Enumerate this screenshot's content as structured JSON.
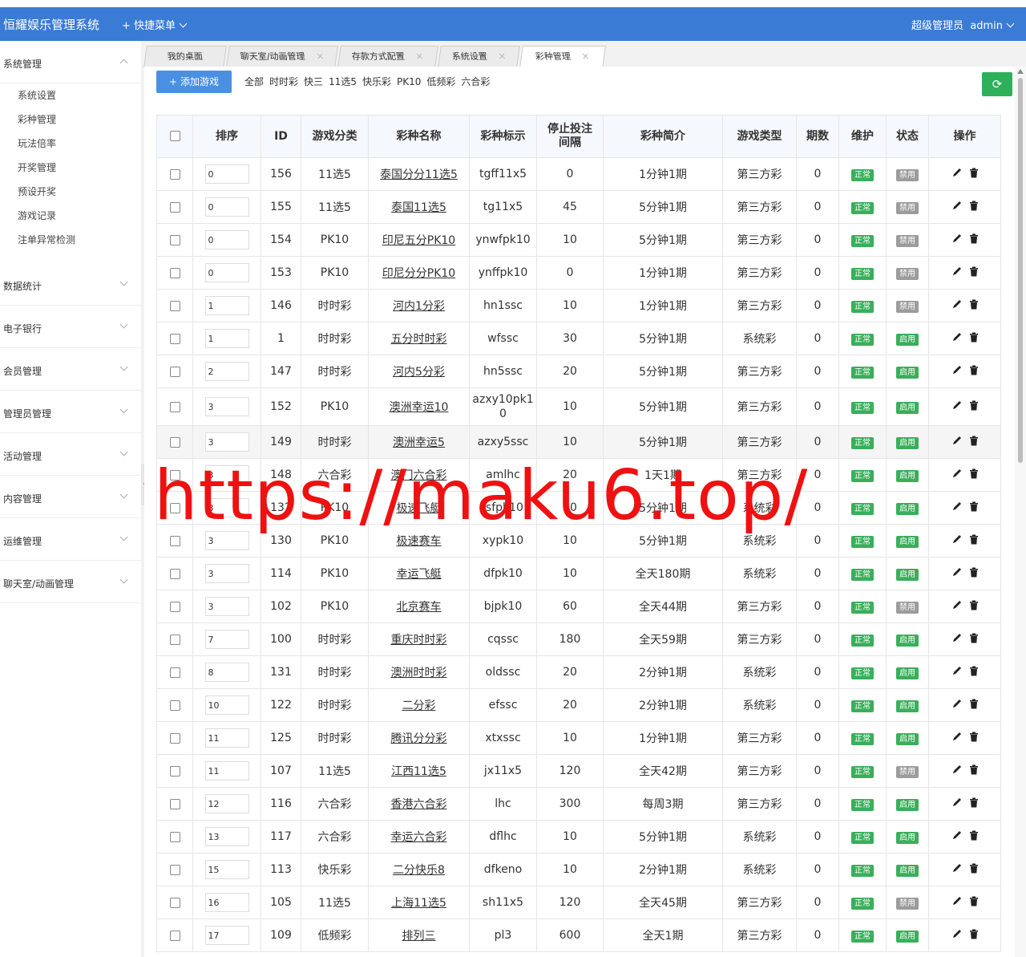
{
  "header": {
    "brand": "恒耀娱乐管理系统",
    "quick_menu": "快捷菜单",
    "role": "超级管理员",
    "user": "admin"
  },
  "sidebar": {
    "system": {
      "label": "系统管理",
      "items": [
        "系统设置",
        "彩种管理",
        "玩法倍率",
        "开奖管理",
        "预设开奖",
        "游戏记录",
        "注单异常检测"
      ]
    },
    "groups": [
      "数据统计",
      "电子银行",
      "会员管理",
      "管理员管理",
      "活动管理",
      "内容管理",
      "运维管理",
      "聊天室/动画管理"
    ]
  },
  "tabs": [
    "我的桌面",
    "聊天室/动画管理",
    "存款方式配置",
    "系统设置",
    "彩种管理"
  ],
  "toolbar": {
    "add_label": "添加游戏",
    "filters": [
      "全部",
      "时时彩",
      "快三",
      "11选5",
      "快乐彩",
      "PK10",
      "低频彩",
      "六合彩"
    ],
    "refresh_glyph": "⟳"
  },
  "table": {
    "headers": [
      "排序",
      "ID",
      "游戏分类",
      "彩种名称",
      "彩种标示",
      "停止投注间隔",
      "彩种简介",
      "游戏类型",
      "期数",
      "维护",
      "状态",
      "操作"
    ],
    "rows": [
      {
        "sort": "0",
        "id": "156",
        "cat": "11选5",
        "name": "泰国分分11选5",
        "code": "tgff11x5",
        "stop": "0",
        "intro": "1分钟1期",
        "type": "第三方彩",
        "periods": "0",
        "maint": "正常",
        "status": "禁用"
      },
      {
        "sort": "0",
        "id": "155",
        "cat": "11选5",
        "name": "泰国11选5",
        "code": "tg11x5",
        "stop": "45",
        "intro": "5分钟1期",
        "type": "第三方彩",
        "periods": "0",
        "maint": "正常",
        "status": "禁用"
      },
      {
        "sort": "0",
        "id": "154",
        "cat": "PK10",
        "name": "印尼五分PK10",
        "code": "ynwfpk10",
        "stop": "10",
        "intro": "5分钟1期",
        "type": "第三方彩",
        "periods": "0",
        "maint": "正常",
        "status": "禁用"
      },
      {
        "sort": "0",
        "id": "153",
        "cat": "PK10",
        "name": "印尼分分PK10",
        "code": "ynffpk10",
        "stop": "0",
        "intro": "1分钟1期",
        "type": "第三方彩",
        "periods": "0",
        "maint": "正常",
        "status": "禁用"
      },
      {
        "sort": "1",
        "id": "146",
        "cat": "时时彩",
        "name": "河内1分彩",
        "code": "hn1ssc",
        "stop": "10",
        "intro": "1分钟1期",
        "type": "第三方彩",
        "periods": "0",
        "maint": "正常",
        "status": "禁用"
      },
      {
        "sort": "1",
        "id": "1",
        "cat": "时时彩",
        "name": "五分时时彩",
        "code": "wfssc",
        "stop": "30",
        "intro": "5分钟1期",
        "type": "系统彩",
        "periods": "0",
        "maint": "正常",
        "status": "启用"
      },
      {
        "sort": "2",
        "id": "147",
        "cat": "时时彩",
        "name": "河内5分彩",
        "code": "hn5ssc",
        "stop": "20",
        "intro": "5分钟1期",
        "type": "第三方彩",
        "periods": "0",
        "maint": "正常",
        "status": "启用"
      },
      {
        "sort": "3",
        "id": "152",
        "cat": "PK10",
        "name": "澳洲幸运10",
        "code": "azxy10pk10",
        "stop": "10",
        "intro": "5分钟1期",
        "type": "第三方彩",
        "periods": "0",
        "maint": "正常",
        "status": "启用"
      },
      {
        "sort": "3",
        "id": "149",
        "cat": "时时彩",
        "name": "澳洲幸运5",
        "code": "azxy5ssc",
        "stop": "10",
        "intro": "5分钟1期",
        "type": "第三方彩",
        "periods": "0",
        "maint": "正常",
        "status": "启用"
      },
      {
        "sort": "3",
        "id": "148",
        "cat": "六合彩",
        "name": "澳门六合彩",
        "code": "amlhc",
        "stop": "20",
        "intro": "1天1期",
        "type": "第三方彩",
        "periods": "0",
        "maint": "正常",
        "status": "启用"
      },
      {
        "sort": "3",
        "id": "132",
        "cat": "PK10",
        "name": "极速飞艇",
        "code": "jsfpk10",
        "stop": "20",
        "intro": "5分钟1期",
        "type": "系统彩",
        "periods": "0",
        "maint": "正常",
        "status": "启用"
      },
      {
        "sort": "3",
        "id": "130",
        "cat": "PK10",
        "name": "极速赛车",
        "code": "xypk10",
        "stop": "10",
        "intro": "5分钟1期",
        "type": "系统彩",
        "periods": "0",
        "maint": "正常",
        "status": "启用"
      },
      {
        "sort": "3",
        "id": "114",
        "cat": "PK10",
        "name": "幸运飞艇",
        "code": "dfpk10",
        "stop": "10",
        "intro": "全天180期",
        "type": "系统彩",
        "periods": "0",
        "maint": "正常",
        "status": "启用"
      },
      {
        "sort": "3",
        "id": "102",
        "cat": "PK10",
        "name": "北京赛车",
        "code": "bjpk10",
        "stop": "60",
        "intro": "全天44期",
        "type": "第三方彩",
        "periods": "0",
        "maint": "正常",
        "status": "禁用"
      },
      {
        "sort": "7",
        "id": "100",
        "cat": "时时彩",
        "name": "重庆时时彩",
        "code": "cqssc",
        "stop": "180",
        "intro": "全天59期",
        "type": "第三方彩",
        "periods": "0",
        "maint": "正常",
        "status": "启用"
      },
      {
        "sort": "8",
        "id": "131",
        "cat": "时时彩",
        "name": "澳洲时时彩",
        "code": "oldssc",
        "stop": "20",
        "intro": "2分钟1期",
        "type": "系统彩",
        "periods": "0",
        "maint": "正常",
        "status": "启用"
      },
      {
        "sort": "10",
        "id": "122",
        "cat": "时时彩",
        "name": "二分彩",
        "code": "efssc",
        "stop": "20",
        "intro": "2分钟1期",
        "type": "系统彩",
        "periods": "0",
        "maint": "正常",
        "status": "启用"
      },
      {
        "sort": "11",
        "id": "125",
        "cat": "时时彩",
        "name": "腾讯分分彩",
        "code": "xtxssc",
        "stop": "10",
        "intro": "1分钟1期",
        "type": "第三方彩",
        "periods": "0",
        "maint": "正常",
        "status": "启用"
      },
      {
        "sort": "11",
        "id": "107",
        "cat": "11选5",
        "name": "江西11选5",
        "code": "jx11x5",
        "stop": "120",
        "intro": "全天42期",
        "type": "第三方彩",
        "periods": "0",
        "maint": "正常",
        "status": "禁用"
      },
      {
        "sort": "12",
        "id": "116",
        "cat": "六合彩",
        "name": "香港六合彩",
        "code": "lhc",
        "stop": "300",
        "intro": "每周3期",
        "type": "第三方彩",
        "periods": "0",
        "maint": "正常",
        "status": "启用"
      },
      {
        "sort": "13",
        "id": "117",
        "cat": "六合彩",
        "name": "幸运六合彩",
        "code": "dflhc",
        "stop": "10",
        "intro": "5分钟1期",
        "type": "系统彩",
        "periods": "0",
        "maint": "正常",
        "status": "启用"
      },
      {
        "sort": "15",
        "id": "113",
        "cat": "快乐彩",
        "name": "二分快乐8",
        "code": "dfkeno",
        "stop": "10",
        "intro": "2分钟1期",
        "type": "系统彩",
        "periods": "0",
        "maint": "正常",
        "status": "启用"
      },
      {
        "sort": "16",
        "id": "105",
        "cat": "11选5",
        "name": "上海11选5",
        "code": "sh11x5",
        "stop": "120",
        "intro": "全天45期",
        "type": "第三方彩",
        "periods": "0",
        "maint": "正常",
        "status": "禁用"
      },
      {
        "sort": "17",
        "id": "109",
        "cat": "低频彩",
        "name": "排列三",
        "code": "pl3",
        "stop": "600",
        "intro": "全天1期",
        "type": "第三方彩",
        "periods": "0",
        "maint": "正常",
        "status": "启用"
      }
    ]
  },
  "colors": {
    "header": "#3a7bd5",
    "add_button": "#4a90e2",
    "refresh": "#2eb05a",
    "badge_green": "#3aae5b",
    "badge_gray": "#9c9c9c",
    "watermark": "#ef1111"
  },
  "watermark": "https://maku6.top/"
}
